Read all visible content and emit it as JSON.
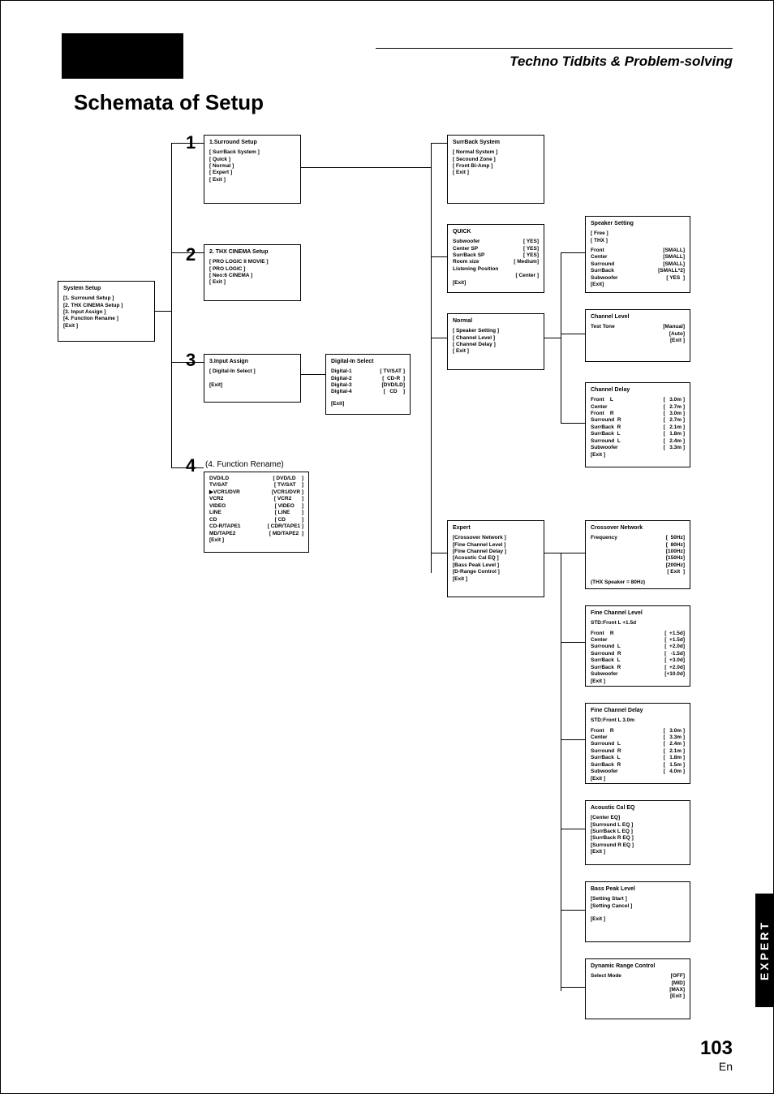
{
  "header": {
    "section_title": "Techno Tidbits & Problem-solving"
  },
  "title": "Schemata of Setup",
  "page_number": "103",
  "page_lang": "En",
  "side_tab": "EXPERT",
  "steps": {
    "s1": "1",
    "s2": "2",
    "s3": "3",
    "s4": "4",
    "s4_label": "(4. Function Rename)"
  },
  "system_setup": {
    "title": "System Setup",
    "items": [
      "[1. Surround Setup     ]",
      "[2. THX CINEMA Setup ]",
      "[3. Input Assign          ]",
      "[4. Function Rename   ]",
      "[Exit                           ]"
    ]
  },
  "surround_setup": {
    "title": "1.Surround Setup",
    "items": [
      "[ SurrBack System ]",
      "[ Quick                    ]",
      "[ Normal                  ]",
      "[ Expert                   ]",
      "[ Exit                       ]"
    ]
  },
  "thx_cinema": {
    "title": "2. THX CINEMA Setup",
    "items": [
      "[ PRO LOGIC II MOVIE ]",
      "[ PRO LOGIC                ]",
      "[ Neo:6 CINEMA           ]",
      "[ Exit                            ]"
    ]
  },
  "input_assign": {
    "title": "3.Input Assign",
    "items": [
      "[ Digital-In Select       ]",
      "",
      "[Exit]"
    ]
  },
  "function_rename": {
    "left": [
      "DVD/LD",
      "TV/SAT",
      "▶VCR1/DVR",
      "VCR2",
      "VIDEO",
      "LINE",
      "CD",
      "CD-R/TAPE1",
      "MD/TAPE2",
      "",
      "[Exit ]"
    ],
    "right": [
      "[ DVD/LD    ]",
      "[ TV/SAT    ]",
      "[VCR1/DVR ]",
      "[ VCR2       ]",
      "[ VIDEO     ]",
      "[ LINE        ]",
      "[ CD           ]",
      "[ CDR/TAPE1 ]",
      "[ MD/TAPE2  ]"
    ]
  },
  "digital_in": {
    "title": "Digital-In Select",
    "rows": [
      [
        "Digital-1",
        "[ TV/SAT ]"
      ],
      [
        "Digital-2",
        "[  CD-R  ]"
      ],
      [
        "Digital-3",
        "[DVD/LD]"
      ],
      [
        "Digital-4",
        "[   CD    ]"
      ]
    ],
    "exit": "[Exit]"
  },
  "surrback_system": {
    "title": "SurrBack System",
    "items": [
      "[ Normal System  ]",
      "[ Secound Zone   ]",
      "[ Front Bi-Amp     ]",
      "[ Exit                    ]"
    ]
  },
  "quick": {
    "title": "QUICK",
    "rows": [
      [
        "Subwoofer",
        "[ YES]"
      ],
      [
        "Center SP",
        "[ YES]"
      ],
      [
        "SurrBack SP",
        "[ YES]"
      ],
      [
        "Room size",
        "[ Medium]"
      ],
      [
        "Listening Position",
        ""
      ],
      [
        "",
        "[ Center ]"
      ],
      [
        "[Exit]",
        ""
      ]
    ]
  },
  "normal": {
    "title": "Normal",
    "items": [
      "[ Speaker Setting  ]",
      "[ Channel Level     ]",
      "[ Channel Delay     ]",
      "[ Exit                      ]"
    ]
  },
  "expert": {
    "title": "Expert",
    "items": [
      "[Crossover Network  ]",
      "[Fine Channel Level   ]",
      "[Fine Channel Delay   ]",
      "[Acoustic Cal EQ        ]",
      "[Bass Peak Level        ]",
      "[D-Range Control       ]",
      "[Exit                            ]"
    ]
  },
  "speaker_setting": {
    "title": "Speaker Setting",
    "top": [
      "[ Free ]",
      "[ THX  ]"
    ],
    "rows": [
      [
        "Front",
        "[SMALL]"
      ],
      [
        "Center",
        "[SMALL]"
      ],
      [
        "Surround",
        "[SMALL]"
      ],
      [
        "SurrBack",
        "[SMALL*2]"
      ],
      [
        "Subwoofer",
        "[ YES  ]"
      ],
      [
        "[Exit]",
        ""
      ]
    ]
  },
  "channel_level": {
    "title": "Channel Level",
    "rows": [
      [
        "Test Tone",
        "[Manual]"
      ],
      [
        "",
        "[Auto]"
      ],
      [
        "",
        "[Exit ]"
      ]
    ]
  },
  "channel_delay": {
    "title": "Channel Delay",
    "rows": [
      [
        "Front    L",
        "[   3.0m ]"
      ],
      [
        "Center",
        "[   2.7m ]"
      ],
      [
        "Front    R",
        "[   3.0m ]"
      ],
      [
        "Surround  R",
        "[   2.7m ]"
      ],
      [
        "SurrBack  R",
        "[   2.1m ]"
      ],
      [
        "SurrBack  L",
        "[   1.8m ]"
      ],
      [
        "Surround  L",
        "[   2.4m ]"
      ],
      [
        "Subwoofer",
        "[   3.3m ]"
      ],
      [
        "[Exit ]",
        ""
      ]
    ]
  },
  "crossover": {
    "title": "Crossover Network",
    "rows": [
      [
        "Frequency",
        "[  50Hz]"
      ],
      [
        "",
        "[  80Hz]"
      ],
      [
        "",
        "[100Hz]"
      ],
      [
        "",
        "[150Hz]"
      ],
      [
        "",
        "[200Hz]"
      ],
      [
        "",
        "[ Exit  ]"
      ]
    ],
    "note": "(THX Speaker = 80Hz)"
  },
  "fine_level": {
    "title": "Fine Channel Level",
    "sub": "STD:Front L       +1.5d",
    "rows": [
      [
        "Front    R",
        "[  +1.5d]"
      ],
      [
        "Center",
        "[  +1.5d]"
      ],
      [
        "Surround  L",
        "[  +2.0d]"
      ],
      [
        "Surround  R",
        "[   -1.5d]"
      ],
      [
        "SurrBack  L",
        "[  +3.0d]"
      ],
      [
        "SurrBack  R",
        "[  +2.0d]"
      ],
      [
        "Subwoofer",
        "[+10.0d]"
      ],
      [
        "[Exit ]",
        ""
      ]
    ]
  },
  "fine_delay": {
    "title": "Fine Channel Delay",
    "sub": "STD:Front L          3.0m",
    "rows": [
      [
        "Front    R",
        "[   3.0m ]"
      ],
      [
        "Center",
        "[   3.3m ]"
      ],
      [
        "Surround  L",
        "[   2.4m ]"
      ],
      [
        "Surround  R",
        "[   2.1m ]"
      ],
      [
        "SurrBack  L",
        "[   1.8m ]"
      ],
      [
        "SurrBack  R",
        "[   1.5m ]"
      ],
      [
        "Subwoofer",
        "[   4.0m ]"
      ],
      [
        "[Exit ]",
        ""
      ]
    ]
  },
  "acoustic": {
    "title": "Acoustic Cal EQ",
    "items": [
      "[Center         EQ]",
      "[Surround L EQ ]",
      "[SurrBack L EQ ]",
      "[SurrBack R EQ ]",
      "[Surround R EQ ]",
      "[Exit ]"
    ]
  },
  "bass_peak": {
    "title": "Bass Peak Level",
    "items": [
      "[Setting Start ]",
      "[Setting Cancel ]",
      "",
      "[Exit ]"
    ]
  },
  "drc": {
    "title": "Dynamic Range Control",
    "rows": [
      [
        "Select Mode",
        "[OFF]"
      ],
      [
        "",
        "[MID]"
      ],
      [
        "",
        "[MAX]"
      ],
      [
        "",
        "[Exit ]"
      ]
    ]
  }
}
